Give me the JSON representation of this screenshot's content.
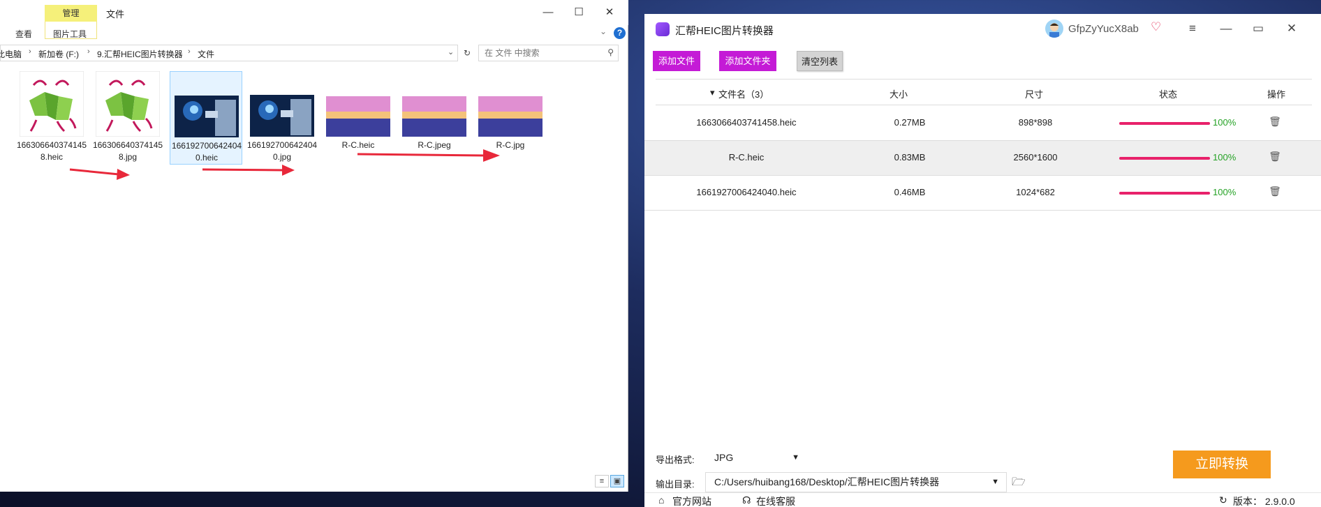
{
  "explorer": {
    "ribbon": {
      "context_tab": "管理",
      "title": "文件",
      "tab_view": "查看",
      "tab_picture_tools": "图片工具",
      "help": "?"
    },
    "window_controls": {
      "minimize": "—",
      "maximize": "☐",
      "close": "✕"
    },
    "address": {
      "crumbs": [
        "此电脑",
        "新加卷 (F:)",
        "9.汇帮HEIC图片转换器",
        "文件"
      ],
      "search_placeholder": "在 文件 中搜索"
    },
    "files": [
      {
        "name": "1663066403741458.heic",
        "thumb": "zongzi"
      },
      {
        "name": "1663066403741458.jpg",
        "thumb": "zongzi"
      },
      {
        "name": "1661927006424040.heic",
        "thumb": "tech-hand",
        "selected": true
      },
      {
        "name": "1661927006424040.jpg",
        "thumb": "tech-hand"
      },
      {
        "name": "R-C.heic",
        "thumb": "lake-sunset"
      },
      {
        "name": "R-C.jpeg",
        "thumb": "lake-sunset"
      },
      {
        "name": "R-C.jpg",
        "thumb": "lake-sunset"
      }
    ],
    "annotation_color": "#e8283a"
  },
  "converter": {
    "app_title": "汇帮HEIC图片转换器",
    "username": "GfpZyYucX8ab",
    "buttons": {
      "add_file": "添加文件",
      "add_folder": "添加文件夹",
      "clear_list": "清空列表"
    },
    "table": {
      "headers": {
        "name": "文件名（3）",
        "size": "大小",
        "dimension": "尺寸",
        "status": "状态",
        "action": "操作"
      },
      "rows": [
        {
          "name": "1663066403741458.heic",
          "size": "0.27MB",
          "dimension": "898*898",
          "progress": 100,
          "pct": "100%"
        },
        {
          "name": "R-C.heic",
          "size": "0.83MB",
          "dimension": "2560*1600",
          "progress": 100,
          "pct": "100%"
        },
        {
          "name": "1661927006424040.heic",
          "size": "0.46MB",
          "dimension": "1024*682",
          "progress": 100,
          "pct": "100%"
        }
      ]
    },
    "export": {
      "format_label": "导出格式:",
      "format_value": "JPG",
      "dir_label": "输出目录:",
      "dir_value": "C:/Users/huibang168/Desktop/汇帮HEIC图片转换器"
    },
    "convert_button": "立即转换",
    "footer": {
      "website": "官方网站",
      "support": "在线客服",
      "version": "版本： 2.9.0.0"
    },
    "colors": {
      "accent_purple": "#c41bd6",
      "convert_orange": "#f59a1d",
      "progress_pink": "#e8216a",
      "pct_green": "#25a225"
    }
  }
}
